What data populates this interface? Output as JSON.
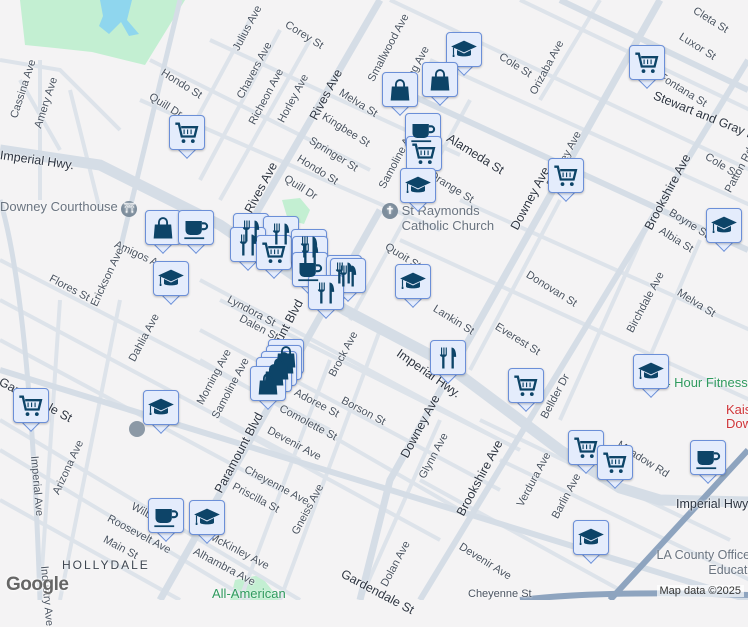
{
  "streets": {
    "julius": "Julius Ave",
    "corey": "Corey St",
    "rives1": "Rives Ave",
    "rives2": "Rives Ave",
    "smallwood": "Smallwood Ave",
    "morning1": "Morning Ave",
    "hondo1": "Hondo St",
    "chavers": "Chavers Ave",
    "richeon": "Richeon Ave",
    "horley": "Horley Ave",
    "melva1": "Melva St",
    "kingbee": "Kingbee St",
    "quill1": "Quill Dr",
    "springer": "Springer St",
    "hondo2": "Hondo St",
    "quill2": "Quill Dr",
    "cassina": "Cassina Ave",
    "amery": "Amery Ave",
    "imperial1": "Imperial Hwy.",
    "imperial2": "Imperial Hwy.",
    "imperial3": "Imperial Hwy",
    "amigos": "Amigos Ave",
    "flores": "Flores St",
    "erickson": "Erickson Ave",
    "lyndora": "Lyndora St",
    "dahlia": "Dahlia Ave",
    "dalen": "Dalen St",
    "paramount1": "Paramount Blvd",
    "paramount2": "Paramount Blvd",
    "morning2": "Morning Ave",
    "samoline1": "Samoline Ave",
    "adoree": "Adoree St",
    "comolette": "Comolette St",
    "devenir1": "Devenir Ave",
    "cheyenne1": "Cheyenne Ave",
    "priscilla": "Priscilla St",
    "gneiss": "Gneiss Ave",
    "brock": "Brock Ave",
    "borson": "Borson St",
    "gardendale1": "Gardendale St",
    "gardendale2": "Gardendale St",
    "arizona": "Arizona Ave",
    "imperial_ave": "Imperial Ave",
    "wilbur": "Wilbur Ave",
    "roosevelt": "Roosevelt Ave",
    "main": "Main St",
    "mckinley": "McKinley Ave",
    "alhambra": "Alhambra Ave",
    "industry": "Industry Ave",
    "cole1": "Cole St",
    "orizaba": "Orizaba Ave",
    "cleta": "Cleta St",
    "luxor": "Luxor St",
    "fontana": "Fontana St",
    "stewart": "Stewart and Gray Rd",
    "alameda": "Alameda St",
    "samoline2": "Samoline Ave",
    "orange": "Orange St",
    "downey1": "Downey Ave",
    "downey2": "Downey Ave",
    "downey3": "Downey Ave",
    "brookshire1": "Brookshire Ave",
    "brookshire2": "Brookshire Ave",
    "cole2": "Cole St",
    "boyne": "Boyne St",
    "albia": "Albia St",
    "patton": "Patton Rd",
    "quoit": "Quoit St",
    "donovan": "Donovan St",
    "melva2": "Melva St",
    "lankin": "Lankin St",
    "everest": "Everest St",
    "birchdale": "Birchdale Ave",
    "bellder": "Bellder Dr",
    "glynn": "Glynn Ave",
    "verdura": "Verdura Ave",
    "barlin": "Barlin Ave",
    "meadow": "Meadow Rd",
    "dolan": "Dolan Ave",
    "devenir2": "Devenir Ave",
    "cheyenne2": "Cheyenne St"
  },
  "places": {
    "courthouse": "Downey Courthouse",
    "church": "St Raymonds Catholic Church",
    "fitness": "24 Hour Fitness",
    "kaiser": "Kaiser Downey",
    "lacoe": "LA County Office of Education",
    "allamerican": "All-American",
    "hollydale": "HOLLYDALE"
  },
  "attribution": "Map data ©2025",
  "logo": "Google",
  "colors": {
    "marker_bg": "#e4ecfc",
    "marker_border": "#6b8fd8",
    "icon": "#0d4468",
    "park": "#c3efd2",
    "water": "#8fd6ee",
    "freeway": "#8ea4bf"
  },
  "markers": [
    "school",
    "shopping",
    "shopping",
    "grocery",
    "cafe",
    "grocery",
    "school",
    "grocery",
    "school",
    "school",
    "grocery",
    "shopping",
    "cafe",
    "school",
    "restaurant",
    "restaurant",
    "restaurant",
    "grocery",
    "restaurant",
    "restaurant",
    "cafe",
    "restaurant",
    "restaurant",
    "restaurant",
    "shopping",
    "shopping",
    "shopping",
    "shopping",
    "shopping",
    "grocery",
    "school",
    "cafe",
    "school",
    "restaurant",
    "grocery",
    "school",
    "grocery",
    "grocery",
    "cafe",
    "school"
  ]
}
